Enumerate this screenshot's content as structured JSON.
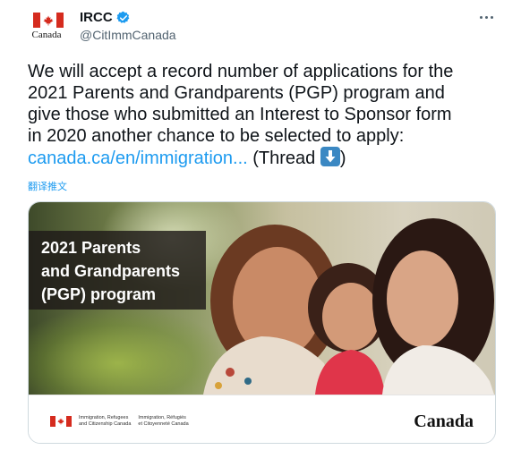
{
  "account": {
    "name": "IRCC",
    "handle": "@CitImmCanada",
    "avatar_wordmark": "Canada",
    "verified_icon": "verified-badge-icon"
  },
  "tweet": {
    "text_line1": "We will accept a record number of applications for the",
    "text_line2": "2021 Parents and Grandparents (PGP) program and",
    "text_line3": "give those who submitted an Interest to Sponsor form",
    "text_line4": "in 2020 another chance to be selected to apply:",
    "link": "canada.ca/en/immigration...",
    "thread_label": " (Thread ",
    "thread_close": ")",
    "emoji": "down-arrow-emoji",
    "translate": "翻译推文"
  },
  "card": {
    "title_line1": "2021 Parents",
    "title_line2": "and Grandparents",
    "title_line3": "(PGP) program",
    "gov_en_line1": "Immigration, Refugees",
    "gov_en_line2": "and Citizenship Canada",
    "gov_fr_line1": "Immigration, Réfugiés",
    "gov_fr_line2": "et Citoyenneté Canada",
    "wordmark": "Canada"
  },
  "colors": {
    "link": "#1d9bf0",
    "flag_red": "#d52b1e",
    "secondary_text": "#536471"
  }
}
